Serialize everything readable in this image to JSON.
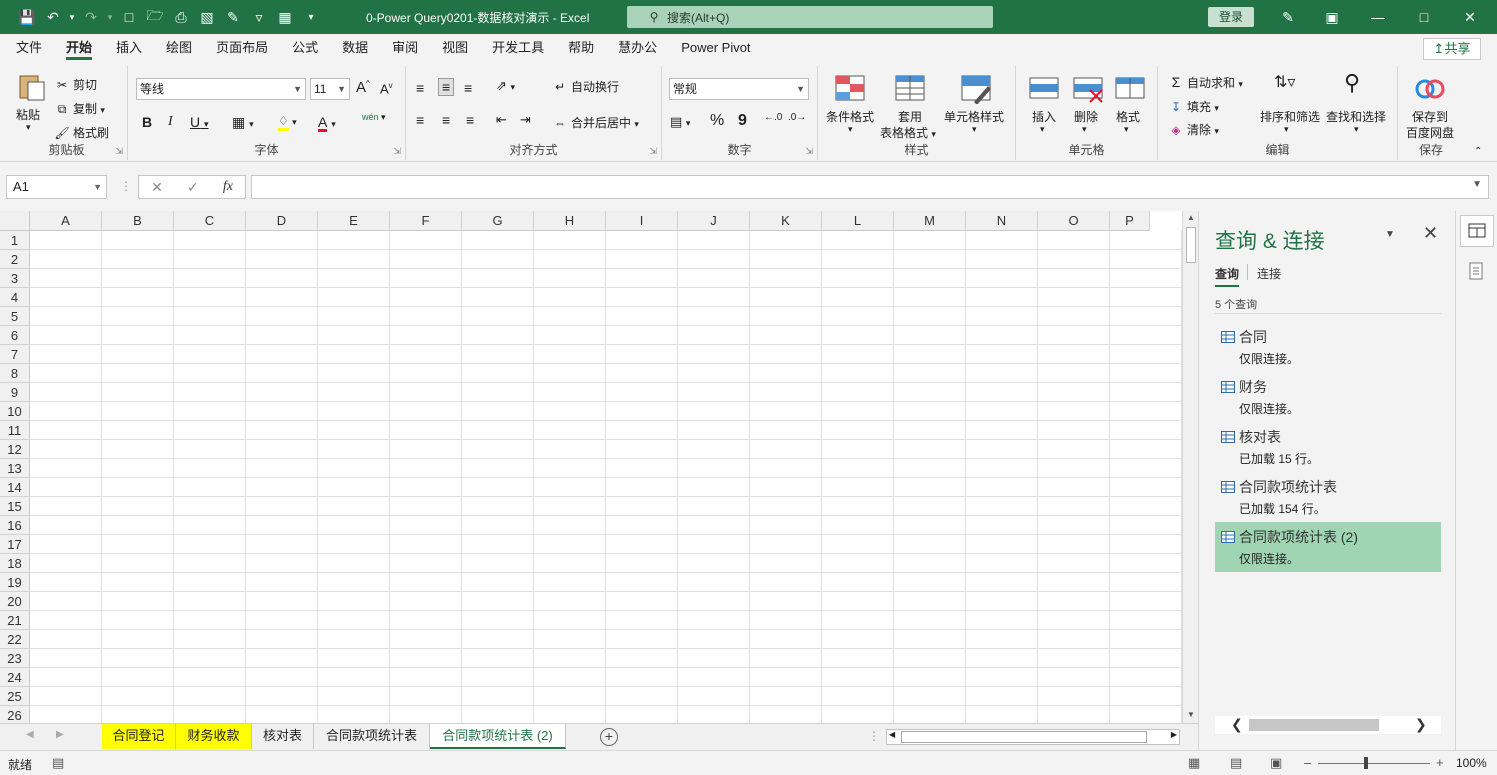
{
  "window": {
    "title": "0-Power Query0201-数据核对演示  -  Excel",
    "search_placeholder": "搜索(Alt+Q)",
    "login_label": "登录",
    "share_label": "共享"
  },
  "menu": [
    "文件",
    "开始",
    "插入",
    "绘图",
    "页面布局",
    "公式",
    "数据",
    "审阅",
    "视图",
    "开发工具",
    "帮助",
    "慧办公",
    "Power Pivot"
  ],
  "ribbon": {
    "clipboard": {
      "label": "剪贴板",
      "paste": "粘贴",
      "cut": "剪切",
      "copy": "复制",
      "format_painter": "格式刷"
    },
    "font": {
      "label": "字体",
      "name": "等线",
      "size": "11",
      "bold": "B",
      "italic": "I",
      "underline": "U",
      "grow": "A",
      "shrink": "A",
      "phonetic": "wén"
    },
    "alignment": {
      "label": "对齐方式",
      "wrap": "自动换行",
      "merge": "合并后居中"
    },
    "number": {
      "label": "数字",
      "format": "常规",
      "percent": "%",
      "comma": "9"
    },
    "styles": {
      "label": "样式",
      "conditional": "条件格式",
      "table_1": "套用",
      "table_2": "表格格式",
      "cell_styles": "单元格样式"
    },
    "cells": {
      "label": "单元格",
      "insert": "插入",
      "delete": "删除",
      "format": "格式"
    },
    "editing": {
      "label": "编辑",
      "autosum": "自动求和",
      "fill": "填充",
      "clear": "清除",
      "sort": "排序和筛选",
      "find": "查找和选择"
    },
    "save": {
      "label": "保存",
      "btn_1": "保存到",
      "btn_2": "百度网盘"
    }
  },
  "formula_bar": {
    "name_box": "A1",
    "fx": "fx",
    "value": ""
  },
  "columns": [
    "A",
    "B",
    "C",
    "D",
    "E",
    "F",
    "G",
    "H",
    "I",
    "J",
    "K",
    "L",
    "M",
    "N",
    "O",
    "P"
  ],
  "rows": [
    "1",
    "2",
    "3",
    "4",
    "5",
    "6",
    "7",
    "8",
    "9",
    "10",
    "11",
    "12",
    "13",
    "14",
    "15",
    "16",
    "17",
    "18",
    "19",
    "20",
    "21",
    "22",
    "23",
    "24",
    "25",
    "26"
  ],
  "sheet_tabs": [
    {
      "label": "合同登记",
      "color": "#ffff00",
      "active": false
    },
    {
      "label": "财务收款",
      "color": "#ffff00",
      "active": false
    },
    {
      "label": "核对表",
      "color": "",
      "active": false
    },
    {
      "label": "合同款项统计表",
      "color": "",
      "active": false
    },
    {
      "label": "合同款项统计表 (2)",
      "color": "",
      "active": true
    }
  ],
  "query_pane": {
    "title": "查询 & 连接",
    "tab_queries": "查询",
    "tab_connections": "连接",
    "count": "5 个查询",
    "items": [
      {
        "name": "合同",
        "status": "仅限连接。",
        "selected": false
      },
      {
        "name": "财务",
        "status": "仅限连接。",
        "selected": false
      },
      {
        "name": "核对表",
        "status": "已加载 15 行。",
        "selected": false
      },
      {
        "name": "合同款项统计表",
        "status": "已加载 154 行。",
        "selected": false
      },
      {
        "name": "合同款项统计表 (2)",
        "status": "仅限连接。",
        "selected": true
      }
    ]
  },
  "status_bar": {
    "ready": "就绪",
    "zoom": "100%"
  },
  "colors": {
    "accent": "#217346",
    "selected_query": "#9fd5b3"
  }
}
